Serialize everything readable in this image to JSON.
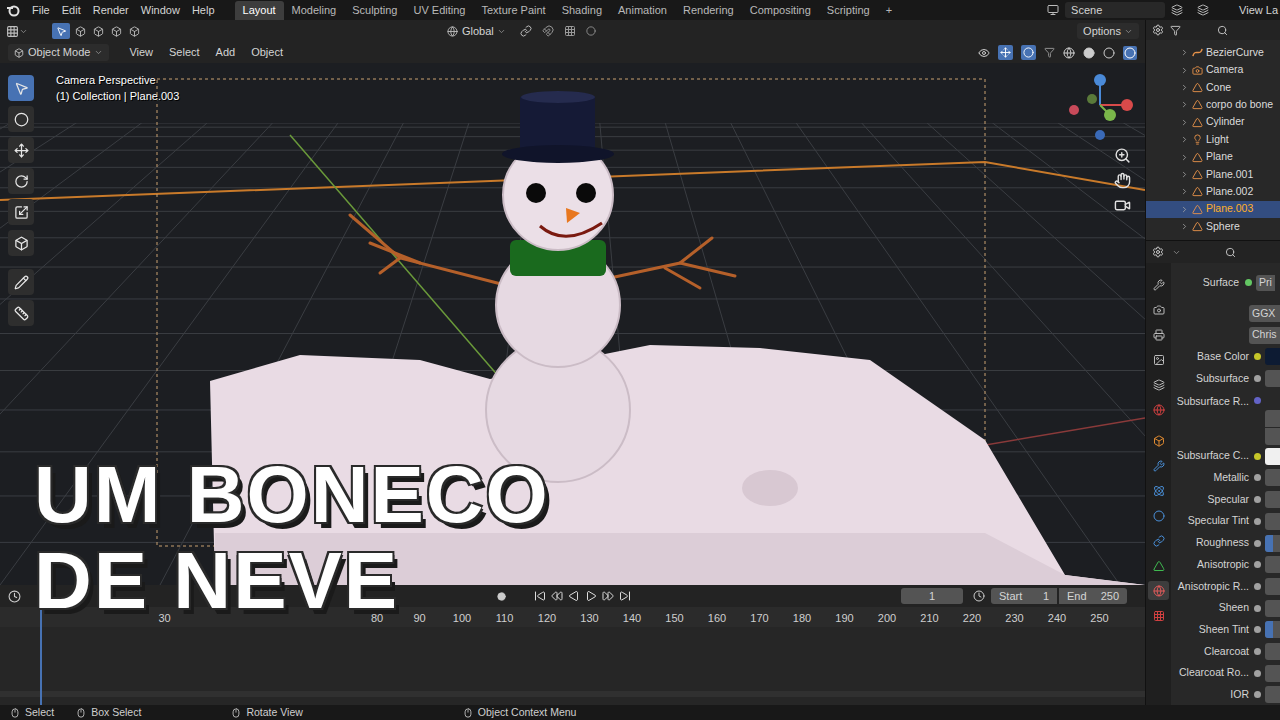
{
  "menu": [
    "File",
    "Edit",
    "Render",
    "Window",
    "Help"
  ],
  "workspaces": [
    {
      "label": "Layout",
      "selected": true
    },
    {
      "label": "Modeling",
      "selected": false
    },
    {
      "label": "Sculpting",
      "selected": false
    },
    {
      "label": "UV Editing",
      "selected": false
    },
    {
      "label": "Texture Paint",
      "selected": false
    },
    {
      "label": "Shading",
      "selected": false
    },
    {
      "label": "Animation",
      "selected": false
    },
    {
      "label": "Rendering",
      "selected": false
    },
    {
      "label": "Compositing",
      "selected": false
    },
    {
      "label": "Scripting",
      "selected": false
    }
  ],
  "workspace_add": "+",
  "scene": "Scene",
  "view_layer": "View La",
  "toolbar": {
    "orientation": "Global",
    "options": "Options"
  },
  "header": {
    "mode": "Object Mode",
    "menus": [
      "View",
      "Select",
      "Add",
      "Object"
    ]
  },
  "viewport": {
    "info": [
      "Camera Perspective",
      "(1) Collection | Plane.003"
    ]
  },
  "tools": [
    {
      "selected": true
    },
    {
      "selected": false
    },
    {
      "selected": false
    },
    {
      "selected": false
    },
    {
      "selected": false
    },
    {
      "selected": false
    },
    {
      "selected": false
    },
    {
      "selected": false
    }
  ],
  "overlay_title": [
    "UM BONECO",
    "DE NEVE"
  ],
  "timeline": {
    "frame": "1",
    "start_label": "Start",
    "start": "1",
    "end_label": "End",
    "end": "250",
    "ruler": [
      "30",
      "80",
      "90",
      "100",
      "110",
      "120",
      "130",
      "140",
      "150",
      "160",
      "170",
      "180",
      "190",
      "200",
      "210",
      "220",
      "230",
      "240",
      "250"
    ]
  },
  "outliner": {
    "items": [
      {
        "name": "BezierCurve",
        "type": "curve",
        "selected": false
      },
      {
        "name": "Camera",
        "type": "camera",
        "selected": false
      },
      {
        "name": "Cone",
        "type": "mesh",
        "selected": false
      },
      {
        "name": "corpo do bone",
        "type": "mesh",
        "selected": false
      },
      {
        "name": "Cylinder",
        "type": "mesh",
        "selected": false
      },
      {
        "name": "Light",
        "type": "light",
        "selected": false
      },
      {
        "name": "Plane",
        "type": "mesh",
        "selected": false
      },
      {
        "name": "Plane.001",
        "type": "mesh",
        "selected": false
      },
      {
        "name": "Plane.002",
        "type": "mesh",
        "selected": false
      },
      {
        "name": "Plane.003",
        "type": "mesh",
        "selected": true
      },
      {
        "name": "Sphere",
        "type": "mesh",
        "selected": false
      }
    ]
  },
  "properties": {
    "tabs": [
      {
        "selected": false
      },
      {
        "selected": false
      },
      {
        "selected": false
      },
      {
        "selected": false
      },
      {
        "selected": false
      },
      {
        "selected": false
      },
      {
        "selected": false
      },
      {
        "selected": false
      },
      {
        "selected": false
      },
      {
        "selected": false
      },
      {
        "selected": false
      },
      {
        "selected": false
      },
      {
        "selected": true
      },
      {
        "selected": false
      }
    ],
    "surface_label": "Surface",
    "surface_value": "Pri",
    "distribution": "GGX",
    "subsurface_method": "Chris",
    "inputs": [
      {
        "label": "Base Color",
        "kind": "color",
        "color": "#c7c729",
        "swatch": "#0d1b33"
      },
      {
        "label": "Subsurface",
        "kind": "value",
        "color": "#a1a1a1"
      },
      {
        "label": "Subsurface R...",
        "kind": "vector",
        "color": "#6363c7"
      },
      {
        "label": "Subsurface C...",
        "kind": "color",
        "color": "#c7c729",
        "swatch": "#f0f0f0"
      },
      {
        "label": "Metallic",
        "kind": "value",
        "color": "#a1a1a1"
      },
      {
        "label": "Specular",
        "kind": "value",
        "color": "#a1a1a1"
      },
      {
        "label": "Specular Tint",
        "kind": "value",
        "color": "#a1a1a1"
      },
      {
        "label": "Roughness",
        "kind": "slider",
        "color": "#a1a1a1",
        "level": 0.5
      },
      {
        "label": "Anisotropic",
        "kind": "value",
        "color": "#a1a1a1"
      },
      {
        "label": "Anisotropic R...",
        "kind": "value",
        "color": "#a1a1a1"
      },
      {
        "label": "Sheen",
        "kind": "value",
        "color": "#a1a1a1"
      },
      {
        "label": "Sheen Tint",
        "kind": "slider",
        "color": "#a1a1a1",
        "level": 0.5
      },
      {
        "label": "Clearcoat",
        "kind": "value",
        "color": "#a1a1a1"
      },
      {
        "label": "Clearcoat Ro...",
        "kind": "value",
        "color": "#a1a1a1"
      },
      {
        "label": "IOR",
        "kind": "value",
        "color": "#a1a1a1"
      }
    ]
  },
  "status_bar": [
    "Select",
    "Box Select",
    "Rotate View",
    "Object Context Menu"
  ]
}
